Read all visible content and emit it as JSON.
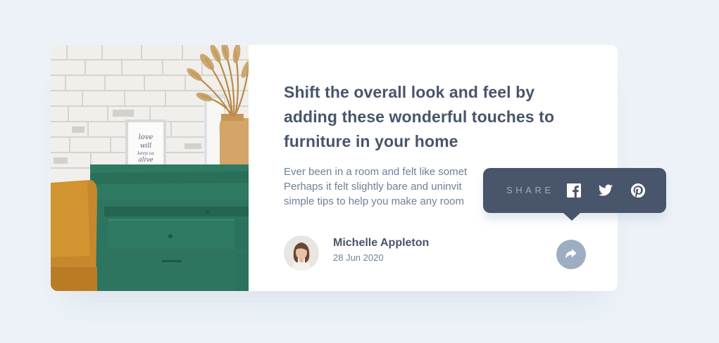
{
  "article": {
    "title": "Shift the overall look and feel by adding these wonderful touches to furniture in your home",
    "description_lines": [
      "Ever been in a room and felt like somet",
      "Perhaps it felt slightly bare and uninvit",
      "simple tips to help you make any room"
    ],
    "image_text": "love will keep us alive"
  },
  "author": {
    "name": "Michelle Appleton",
    "date": "28 Jun 2020"
  },
  "share": {
    "label": "SHARE",
    "networks": [
      "facebook-icon",
      "twitter-icon",
      "pinterest-icon"
    ],
    "toggle_icon": "share-arrow-icon"
  },
  "colors": {
    "background": "#ecf2f8",
    "card": "#ffffff",
    "title": "#48556a",
    "text": "#6e8098",
    "popover": "#48556a",
    "share_label": "#9daec2",
    "toggle": "#9daec2"
  }
}
